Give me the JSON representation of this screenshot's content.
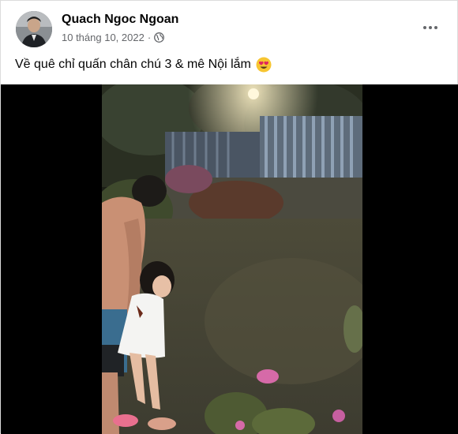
{
  "post": {
    "author": "Quach Ngoc Ngoan",
    "date": "10 tháng 10, 2022",
    "separator": "·",
    "privacy_icon": "globe-icon",
    "more_icon": "more-options-icon",
    "caption": "Về quê chỉ quấn chân chú 3 & mê Nội lắm",
    "caption_emoji": "heart-eyes-emoji"
  },
  "video": {
    "description_icon": "video-frame",
    "background_color": "#000000"
  }
}
